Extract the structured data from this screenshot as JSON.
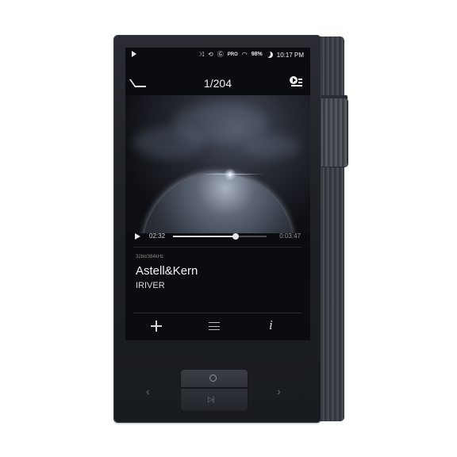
{
  "status_bar": {
    "icons": [
      "play-indicator-icon",
      "shuffle-icon",
      "repeat-icon",
      "gapless-icon",
      "pro-badge",
      "wifi-icon",
      "moon-icon"
    ],
    "pro_label": "PRO",
    "battery": "98%",
    "time": "10:17 PM"
  },
  "header": {
    "track_count": "1/204",
    "back_icon": "back-arrow-icon",
    "playlist_icon": "now-playing-list-icon"
  },
  "progress": {
    "elapsed": "02:32",
    "total": "0:03:47",
    "fraction": 0.67
  },
  "track": {
    "format": "32bit/384kHz",
    "title": "Astell&Kern",
    "artist": "IRIVER"
  },
  "bottom_bar": {
    "icons": [
      "add-icon",
      "menu-icon",
      "info-icon"
    ],
    "info_glyph": "i"
  },
  "hardware": {
    "prev_glyph": "‹",
    "next_glyph": "›",
    "playpause_glyph": "▷|"
  },
  "colors": {
    "device": "#1e2126",
    "screen": "#0b0c0f",
    "text": "#f4f4f4"
  }
}
